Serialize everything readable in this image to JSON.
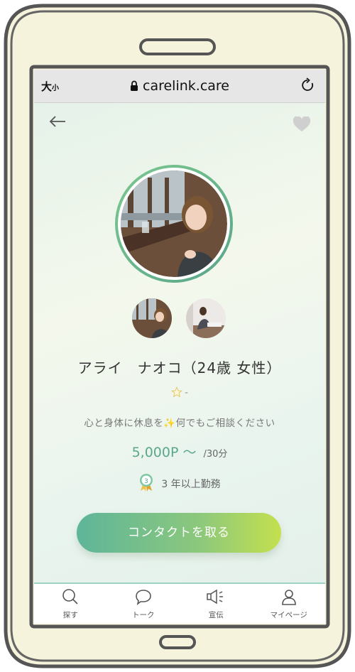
{
  "browser": {
    "text_size_big": "大",
    "text_size_small": "小",
    "url": "carelink.care"
  },
  "profile": {
    "name": "アライ　ナオコ（24歳 女性）",
    "rating": "-",
    "tagline": "心と身体に休息を✨何でもご相談ください",
    "price": "5,000P 〜",
    "price_unit": "/30分",
    "tenure": "3 年以上勤務",
    "badge_number": "3"
  },
  "cta": {
    "label": "コンタクトを取る"
  },
  "tabbar": {
    "items": [
      {
        "label": "探す",
        "icon": "search-icon"
      },
      {
        "label": "トーク",
        "icon": "chat-bubble-icon"
      },
      {
        "label": "宣伝",
        "icon": "megaphone-icon"
      },
      {
        "label": "マイページ",
        "icon": "person-icon"
      }
    ]
  },
  "colors": {
    "accent": "#5aa88c",
    "cta_start": "#5eb59a",
    "cta_end": "#c4e04e",
    "frame": "#f6f3dc"
  }
}
